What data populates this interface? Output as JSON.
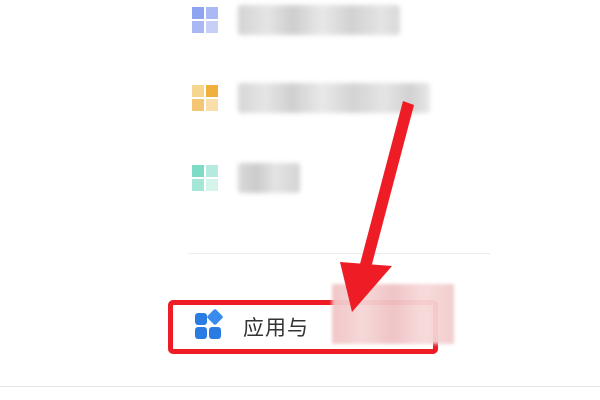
{
  "menu": {
    "items": [
      {
        "icon": "blue-grid-icon",
        "label_visible": false
      },
      {
        "icon": "orange-grid-icon",
        "label_visible": false
      },
      {
        "icon": "teal-grid-icon",
        "label_visible": false
      }
    ],
    "apps_item": {
      "icon": "apps-icon",
      "label": "应用与"
    }
  },
  "colors": {
    "highlight_border": "#ee1c25",
    "arrow": "#ee1c25",
    "apps_icon": "#2b7ce2",
    "blur_mask": "#f1c4c6"
  }
}
